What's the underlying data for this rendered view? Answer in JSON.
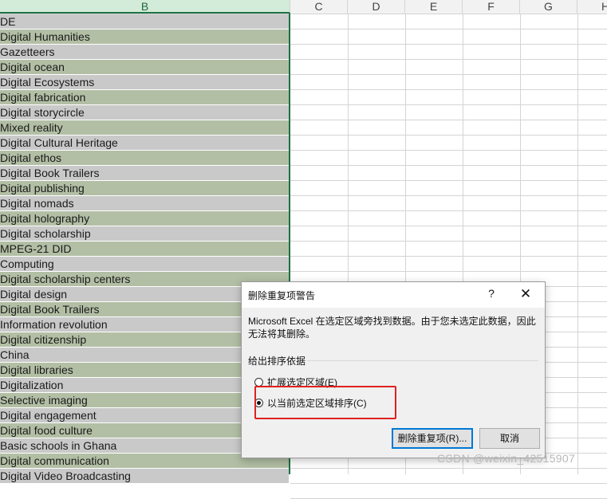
{
  "columns": {
    "b": "B",
    "c": "C",
    "d": "D",
    "e": "E",
    "f": "F",
    "g": "G",
    "h": "H"
  },
  "rows": [
    "DE",
    "Digital Humanities",
    "Gazetteers",
    "Digital ocean",
    "Digital Ecosystems",
    "Digital fabrication",
    "Digital storycircle",
    "Mixed reality",
    "Digital Cultural Heritage",
    "Digital ethos",
    "Digital Book Trailers",
    "Digital publishing",
    "Digital nomads",
    "Digital holography",
    "Digital scholarship",
    "MPEG-21 DID",
    "Computing",
    "Digital scholarship centers",
    "Digital design",
    "Digital Book Trailers",
    "Information revolution",
    "Digital citizenship",
    "China",
    "Digital libraries",
    "Digitalization",
    "Selective imaging",
    "Digital engagement",
    "Digital food culture",
    "Basic schools in Ghana",
    "Digital communication",
    "Digital Video Broadcasting"
  ],
  "colors": {
    "row_gray": "#c9c9c9",
    "row_green": "#b3bfa5",
    "selection": "#1e7145",
    "highlight": "#e02020",
    "primary_btn_border": "#0078d7"
  },
  "dialog": {
    "title": "删除重复项警告",
    "help": "?",
    "close": "✕",
    "message": "Microsoft Excel 在选定区域旁找到数据。由于您未选定此数据，因此无法将其删除。",
    "group_label": "给出排序依据",
    "option_expand": "扩展选定区域(E)",
    "option_current": "以当前选定区域排序(C)",
    "selected_option": "current",
    "ok_button": "删除重复项(R)...",
    "cancel_button": "取消"
  },
  "watermark": "CSDN @weixin_42515907"
}
